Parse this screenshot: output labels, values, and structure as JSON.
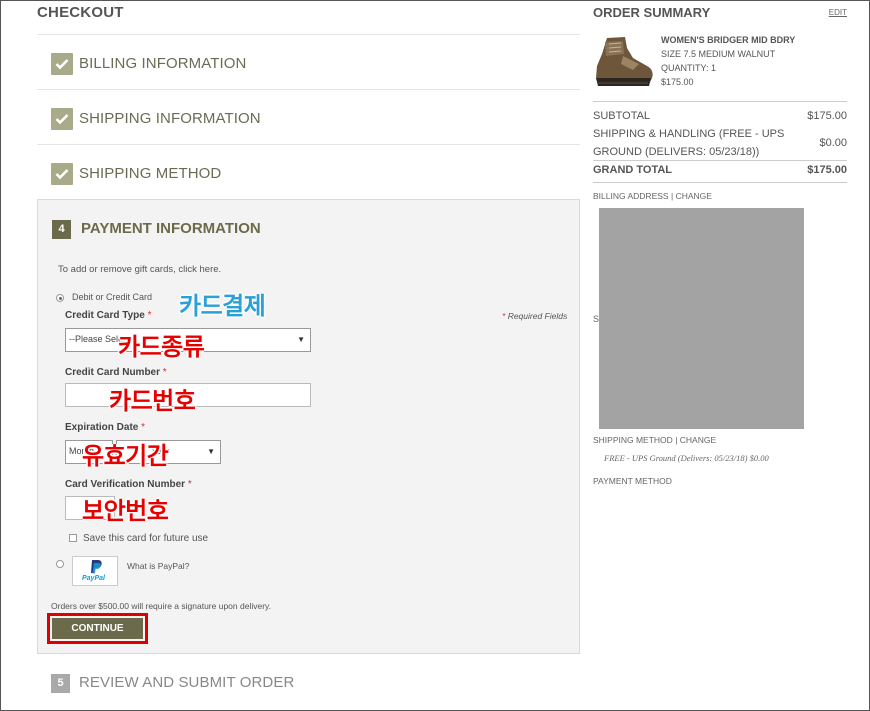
{
  "checkout": {
    "heading": "CHECKOUT",
    "steps": [
      {
        "label": "BILLING INFORMATION"
      },
      {
        "label": "SHIPPING INFORMATION"
      },
      {
        "label": "SHIPPING METHOD"
      }
    ],
    "payment": {
      "number": "4",
      "title": "PAYMENT INFORMATION",
      "gift_text": "To add or remove gift cards, click here.",
      "debit_label": "Debit or Credit Card",
      "required_note": "Required Fields",
      "required_mark": "*",
      "card_type_label": "Credit Card Type",
      "card_type_value": "--Please Select",
      "card_number_label": "Credit Card Number",
      "expiration_label": "Expiration Date",
      "exp_month_value": "Month",
      "exp_year_value": "Year",
      "cvn_label": "Card Verification Number",
      "save_card_label": "Save this card for future use",
      "paypal_logo": "PayPal",
      "paypal_link": "What is PayPal?",
      "signature_note": "Orders over $500.00 will require a signature upon delivery.",
      "continue_label": "CONTINUE"
    },
    "review": {
      "number": "5",
      "label": "REVIEW AND SUBMIT ORDER"
    }
  },
  "annotations": {
    "card_payment": "카드결제",
    "card_type": "카드종류",
    "card_number": "카드번호",
    "expiration": "유효기간",
    "security_code": "보안번호"
  },
  "summary": {
    "title": "ORDER SUMMARY",
    "edit": "EDIT",
    "product": {
      "name": "WOMEN'S BRIDGER MID BDRY",
      "size": "SIZE 7.5 MEDIUM WALNUT",
      "quantity": "QUANTITY: 1",
      "price": "$175.00"
    },
    "subtotal_label": "SUBTOTAL",
    "subtotal_value": "$175.00",
    "shipping_label_1": "SHIPPING & HANDLING (FREE - UPS",
    "shipping_label_2": "GROUND (DELIVERS: 05/23/18))",
    "shipping_value": "$0.00",
    "grand_label": "GRAND TOTAL",
    "grand_value": "$175.00",
    "billing_address": "BILLING ADDRESS",
    "change": "CHANGE",
    "sep": "|",
    "s_letter": "S",
    "shipping_method": "SHIPPING METHOD",
    "shipping_method_detail": "FREE - UPS Ground (Delivers: 05/23/18) $0.00",
    "payment_method": "PAYMENT METHOD"
  },
  "colors": {
    "accent": "#6b6b4c",
    "highlight": "#e00000",
    "annotation_red": "#e60000",
    "annotation_blue": "#2b9fd8"
  }
}
